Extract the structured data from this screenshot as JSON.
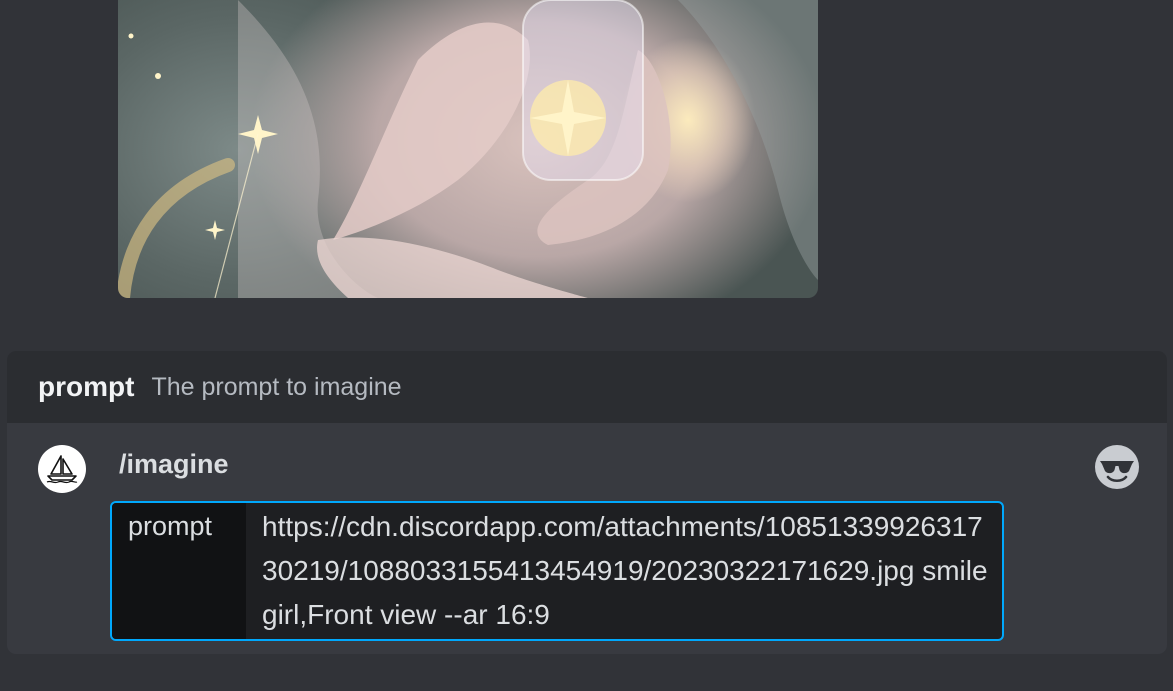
{
  "attachment": {
    "kind": "image",
    "icon": "image-attachment"
  },
  "option_hint": {
    "name": "prompt",
    "description": "The prompt to imagine"
  },
  "command": {
    "name": "/imagine",
    "bot_avatar_icon": "sailboat-icon",
    "emoji_icon": "sunglasses-emoji-icon"
  },
  "input": {
    "label": "prompt",
    "value": "https://cdn.discordapp.com/attachments/1085133992631730219/1088033155413454919/20230322171629.jpg smile girl,Front view --ar 16:9"
  },
  "colors": {
    "background": "#313338",
    "panel": "#383a40",
    "header": "#2b2d31",
    "focus_border": "#00a8fc"
  }
}
